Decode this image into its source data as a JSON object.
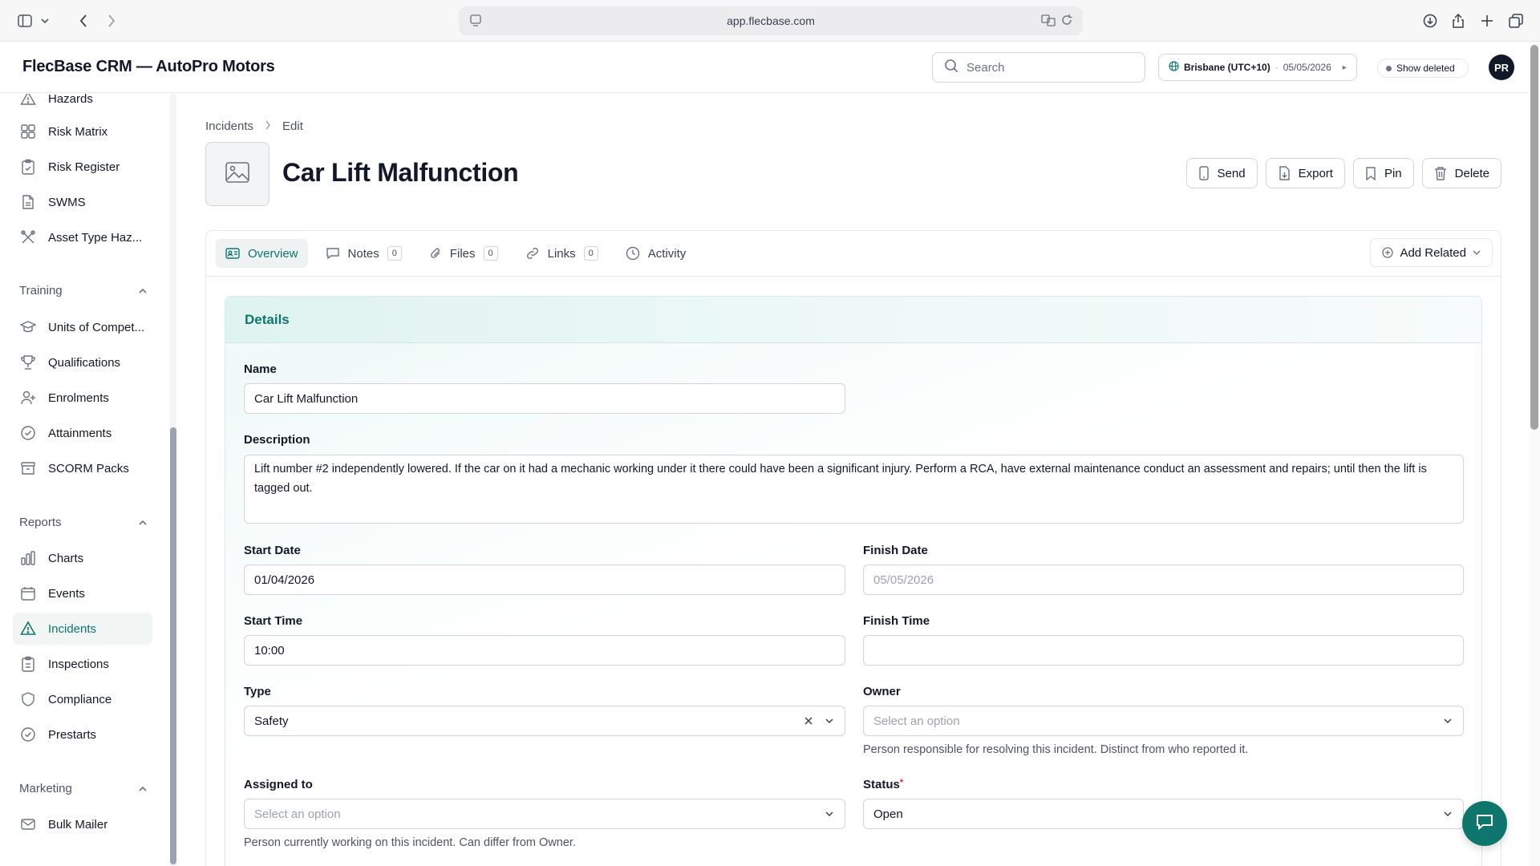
{
  "browser": {
    "url": "app.flecbase.com"
  },
  "header": {
    "app_title": "FlecBase CRM — AutoPro Motors",
    "search_placeholder": "Search",
    "timezone": "Brisbane (UTC+10)",
    "date": "05/05/2026",
    "show_deleted": "Show deleted",
    "avatar_initials": "PR"
  },
  "sidebar": {
    "top_items": [
      {
        "label": "Hazards",
        "icon": "warning-icon"
      },
      {
        "label": "Risk Matrix",
        "icon": "grid-icon"
      },
      {
        "label": "Risk Register",
        "icon": "clipboard-icon"
      },
      {
        "label": "SWMS",
        "icon": "document-icon"
      },
      {
        "label": "Asset Type Haz...",
        "icon": "tools-icon"
      }
    ],
    "training": {
      "title": "Training",
      "items": [
        {
          "label": "Units of Compet...",
          "icon": "graduation-cap-icon"
        },
        {
          "label": "Qualifications",
          "icon": "trophy-icon"
        },
        {
          "label": "Enrolments",
          "icon": "user-plus-icon"
        },
        {
          "label": "Attainments",
          "icon": "check-circle-icon"
        },
        {
          "label": "SCORM Packs",
          "icon": "archive-icon"
        }
      ]
    },
    "reports": {
      "title": "Reports",
      "items": [
        {
          "label": "Charts",
          "icon": "bar-chart-icon"
        },
        {
          "label": "Events",
          "icon": "calendar-icon"
        },
        {
          "label": "Incidents",
          "icon": "alert-triangle-icon",
          "active": true
        },
        {
          "label": "Inspections",
          "icon": "clipboard-check-icon"
        },
        {
          "label": "Compliance",
          "icon": "shield-icon"
        },
        {
          "label": "Prestarts",
          "icon": "check-circle-icon"
        }
      ]
    },
    "marketing": {
      "title": "Marketing",
      "items": [
        {
          "label": "Bulk Mailer",
          "icon": "mail-icon"
        }
      ]
    }
  },
  "breadcrumb": {
    "parent": "Incidents",
    "current": "Edit"
  },
  "record": {
    "title": "Car Lift Malfunction"
  },
  "actions": {
    "send": "Send",
    "export": "Export",
    "pin": "Pin",
    "delete": "Delete"
  },
  "tabs": {
    "overview": "Overview",
    "notes": "Notes",
    "notes_count": "0",
    "files": "Files",
    "files_count": "0",
    "links": "Links",
    "links_count": "0",
    "activity": "Activity",
    "add_related": "Add Related"
  },
  "details": {
    "title": "Details",
    "name_label": "Name",
    "name_value": "Car Lift Malfunction",
    "description_label": "Description",
    "description_value": "Lift number #2 independently lowered. If the car on it had a mechanic working under it there could have been a significant injury. Perform a RCA, have external maintenance conduct an assessment and repairs; until then the lift is tagged out.",
    "start_date_label": "Start Date",
    "start_date_value": "01/04/2026",
    "finish_date_label": "Finish Date",
    "finish_date_placeholder": "05/05/2026",
    "start_time_label": "Start Time",
    "start_time_value": "10:00",
    "finish_time_label": "Finish Time",
    "finish_time_value": "",
    "type_label": "Type",
    "type_value": "Safety",
    "owner_label": "Owner",
    "owner_placeholder": "Select an option",
    "owner_help": "Person responsible for resolving this incident. Distinct from who reported it.",
    "assigned_label": "Assigned to",
    "assigned_placeholder": "Select an option",
    "assigned_help": "Person currently working on this incident. Can differ from Owner.",
    "status_label": "Status",
    "status_required": "*",
    "status_value": "Open"
  },
  "colors": {
    "accent": "#0f766e",
    "active_bg": "#f1f5f4"
  }
}
